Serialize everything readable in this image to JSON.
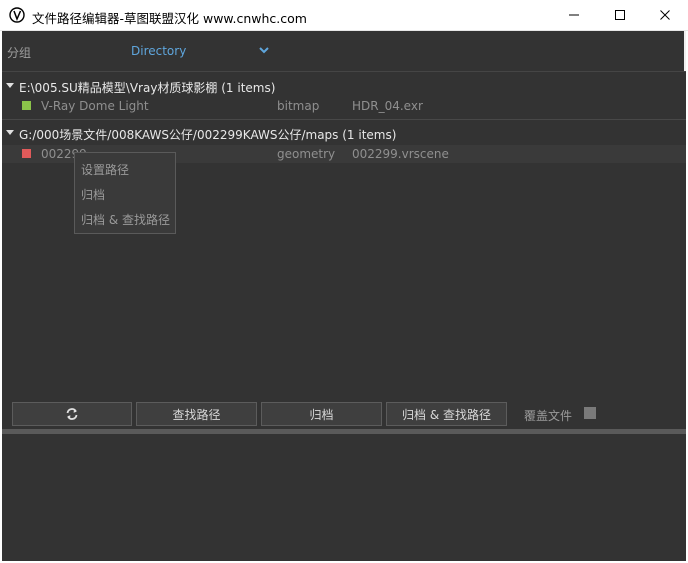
{
  "window": {
    "title": "文件路径编辑器-草图联盟汉化 www.cnwhc.com",
    "icons": {
      "app": "app-logo-icon",
      "minimize": "minimize-icon",
      "maximize": "maximize-icon",
      "close": "close-icon"
    }
  },
  "grouping": {
    "label": "分组",
    "selected": "Directory",
    "accent": "#5fa6dd"
  },
  "groups": [
    {
      "header": "E:\\005.SU精品模型\\Vray材质球影棚 (1 items)",
      "rows": [
        {
          "swatch_color": "#8bc34a",
          "name": "V-Ray Dome Light",
          "type": "bitmap",
          "file": "HDR_04.exr"
        }
      ]
    },
    {
      "header": "G:/000场景文件/008KAWS公仔/002299KAWS公仔/maps (1 items)",
      "rows": [
        {
          "swatch_color": "#e05a5a",
          "name": "002299",
          "type": "geometry",
          "file": "002299.vrscene"
        }
      ]
    }
  ],
  "context_menu": {
    "items": [
      "设置路径",
      "归档",
      "归档 & 查找路径"
    ]
  },
  "actions": {
    "refresh_icon": "refresh-icon",
    "find_path": "查找路径",
    "archive": "归档",
    "archive_find": "归档 & 查找路径",
    "overwrite_label": "覆盖文件",
    "overwrite_checked": false
  }
}
